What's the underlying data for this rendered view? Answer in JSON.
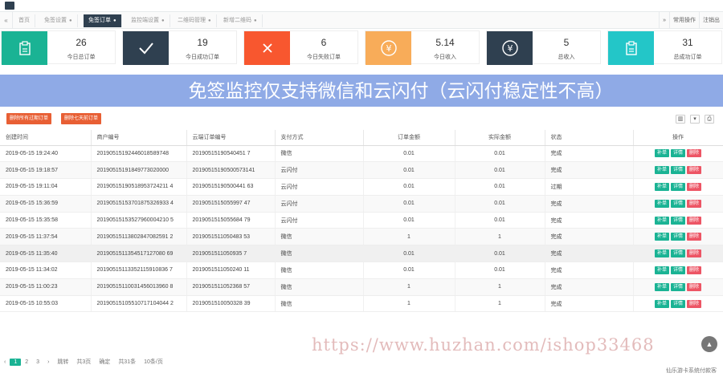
{
  "tabs": [
    {
      "label": "首页",
      "active": false,
      "closable": false
    },
    {
      "label": "免签设置",
      "active": false,
      "closable": true
    },
    {
      "label": "免签订单",
      "active": true,
      "closable": true
    },
    {
      "label": "监控端设置",
      "active": false,
      "closable": true
    },
    {
      "label": "二维码管理",
      "active": false,
      "closable": true
    },
    {
      "label": "新增二维码",
      "active": false,
      "closable": true
    }
  ],
  "tabs_right": {
    "ops": "常用操作",
    "logout": "注销出"
  },
  "stats": [
    {
      "value": "26",
      "label": "今日总订单",
      "color": "#1ab394",
      "icon": "clipboard-icon"
    },
    {
      "value": "19",
      "label": "今日成功订单",
      "color": "#2f4050",
      "icon": "check-icon"
    },
    {
      "value": "6",
      "label": "今日失败订单",
      "color": "#f8572f",
      "icon": "close-icon"
    },
    {
      "value": "5.14",
      "label": "今日收入",
      "color": "#f8ac59",
      "icon": "yen-icon"
    },
    {
      "value": "5",
      "label": "总收入",
      "color": "#2f4050",
      "icon": "yen-icon"
    },
    {
      "value": "31",
      "label": "总成功订单",
      "color": "#23c6c8",
      "icon": "clipboard-icon"
    }
  ],
  "banner": "免签监控仅支持微信和云闪付（云闪付稳定性不高）",
  "toolbar": {
    "btn1": "删除所有过期订单",
    "btn2": "删除七天前订单"
  },
  "table": {
    "headers": [
      "创建时间",
      "商户编号",
      "云端订单编号",
      "支付方式",
      "订单金额",
      "实际金额",
      "状态",
      "操作"
    ],
    "rows": [
      [
        "2019-05-15 19:24:40",
        "20190515192446018589748",
        "20190515190540451 7",
        "微信",
        "0.01",
        "0.01",
        "完成"
      ],
      [
        "2019-05-15 19:18:57",
        "20190515191849773020000",
        "20190515190500573141",
        "云闪付",
        "0.01",
        "0.01",
        "完成"
      ],
      [
        "2019-05-15 19:11:04",
        "20190515190518953724211 4",
        "20190515190500441 63",
        "云闪付",
        "0.01",
        "0.01",
        "过期"
      ],
      [
        "2019-05-15 15:36:59",
        "20190515153701875326933 4",
        "2019051515055997 47",
        "云闪付",
        "0.01",
        "0.01",
        "完成"
      ],
      [
        "2019-05-15 15:35:58",
        "20190515153527960004210 5",
        "2019051515055684 79",
        "云闪付",
        "0.01",
        "0.01",
        "完成"
      ],
      [
        "2019-05-15 11:37:54",
        "20190515113802847082591 2",
        "2019051511050483 53",
        "微信",
        "1",
        "1",
        "完成"
      ],
      [
        "2019-05-15 11:35:40",
        "2019051511354517127080 69",
        "2019051511050935 7",
        "微信",
        "0.01",
        "0.01",
        "完成"
      ],
      [
        "2019-05-15 11:34:02",
        "20190515113352115910836 7",
        "2019051511050240 11",
        "微信",
        "0.01",
        "0.01",
        "完成"
      ],
      [
        "2019-05-15 11:00:23",
        "20190515110031456013960 8",
        "2019051511052368 57",
        "微信",
        "1",
        "1",
        "完成"
      ],
      [
        "2019-05-15 10:55:03",
        "20190515105510717104044 2",
        "2019051510050328 39",
        "微信",
        "1",
        "1",
        "完成"
      ]
    ],
    "ops": {
      "add": "补单",
      "detail": "详情",
      "del": "删除"
    }
  },
  "pager": {
    "prev": "‹",
    "p1": "1",
    "p2": "2",
    "p3": "3",
    "next": "›",
    "jump": "跳转",
    "total": "共3页",
    "go": "确定",
    "count": "共31条",
    "size": "10条/页"
  },
  "footer": "仙乐游卡系统付款客",
  "watermark": "https://www.huzhan.com/ishop33468"
}
